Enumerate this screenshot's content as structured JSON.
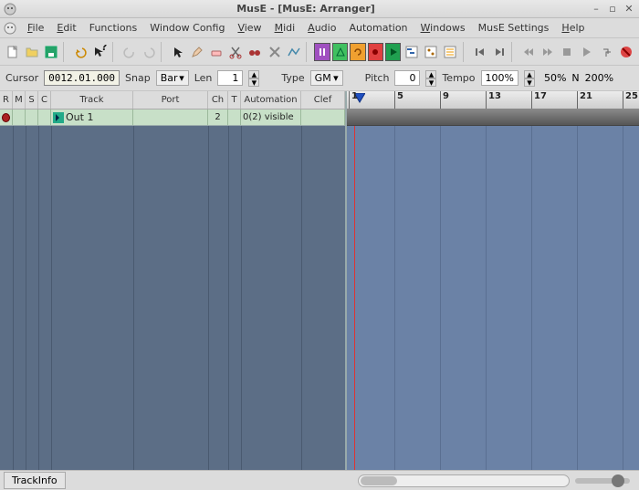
{
  "window": {
    "title": "MusE - [MusE: Arranger]"
  },
  "menu": [
    "File",
    "Edit",
    "Functions",
    "Window Config",
    "View",
    "Midi",
    "Audio",
    "Automation",
    "Windows",
    "MusE Settings",
    "Help"
  ],
  "controls": {
    "cursor_label": "Cursor",
    "cursor_value": "0012.01.000",
    "snap_label": "Snap",
    "snap_value": "Bar",
    "len_label": "Len",
    "len_value": "1",
    "type_label": "Type",
    "type_value": "GM",
    "pitch_label": "Pitch",
    "pitch_value": "0",
    "tempo_label": "Tempo",
    "tempo_value": "100%",
    "zoom_half": "50%",
    "n_label": "N",
    "zoom_double": "200%"
  },
  "track_headers": [
    "R",
    "M",
    "S",
    "C",
    "Track",
    "Port",
    "Ch",
    "T",
    "Automation",
    "Clef"
  ],
  "track": {
    "name": "Out 1",
    "ch": "2",
    "automation": "0(2) visible"
  },
  "ruler_ticks": [
    "1",
    "5",
    "9",
    "13",
    "17",
    "21",
    "25"
  ],
  "bottom": {
    "trackinfo": "TrackInfo"
  }
}
